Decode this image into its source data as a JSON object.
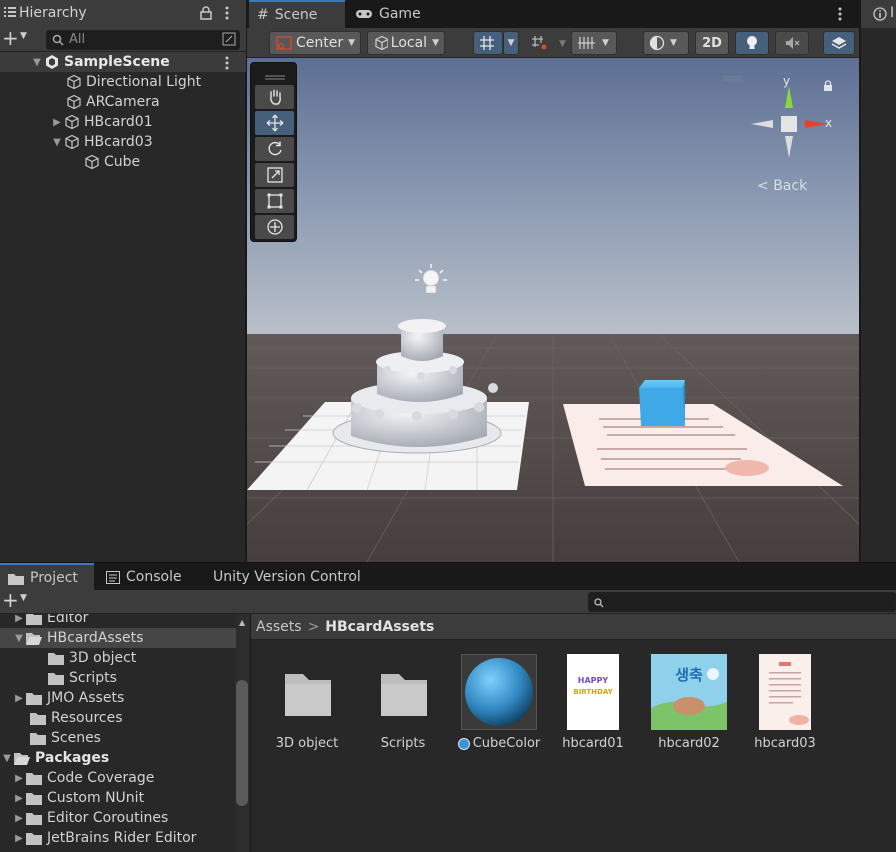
{
  "hierarchy": {
    "tab_label": "Hierarchy",
    "search_placeholder": "All",
    "add_label": "+",
    "items": [
      {
        "label": "SampleScene"
      },
      {
        "label": "Directional Light"
      },
      {
        "label": "ARCamera"
      },
      {
        "label": "HBcard01"
      },
      {
        "label": "HBcard03"
      },
      {
        "label": "Cube"
      }
    ]
  },
  "scene": {
    "tabs": [
      {
        "label": "Scene"
      },
      {
        "label": "Game"
      }
    ],
    "toolbar": {
      "pivot_label": "Center",
      "space_label": "Local",
      "mode_2d_label": "2D"
    },
    "gizmo": {
      "y_label": "y",
      "x_label": "x",
      "back_label": "Back"
    }
  },
  "inspector_stub_label": "I",
  "project": {
    "tabs": [
      {
        "label": "Project"
      },
      {
        "label": "Console"
      },
      {
        "label": "Unity Version Control"
      }
    ],
    "add_label": "+",
    "tree": [
      {
        "label": "Editor"
      },
      {
        "label": "HBcardAssets"
      },
      {
        "label": "3D object"
      },
      {
        "label": "Scripts"
      },
      {
        "label": "JMO Assets"
      },
      {
        "label": "Resources"
      },
      {
        "label": "Scenes"
      },
      {
        "label": "Packages"
      },
      {
        "label": "Code Coverage"
      },
      {
        "label": "Custom NUnit"
      },
      {
        "label": "Editor Coroutines"
      },
      {
        "label": "JetBrains Rider Editor"
      }
    ],
    "breadcrumb": {
      "root": "Assets",
      "separator": ">",
      "current": "HBcardAssets"
    },
    "assets": [
      {
        "label": "3D object"
      },
      {
        "label": "Scripts"
      },
      {
        "label": "CubeColor"
      },
      {
        "label": "hbcard01"
      },
      {
        "label": "hbcard02"
      },
      {
        "label": "hbcard03"
      }
    ],
    "card_texts": {
      "card01_line1": "HAPPY",
      "card01_line2": "BIRTHDAY",
      "card02_title": "생축"
    }
  },
  "colors": {
    "accent": "#3a79bb",
    "selected_button": "#46607c",
    "panel": "#282828",
    "toolbar": "#3c3c3c",
    "sky_top": "#5d6f94",
    "ground": "#4a4242",
    "cube": "#3fa9e8"
  }
}
